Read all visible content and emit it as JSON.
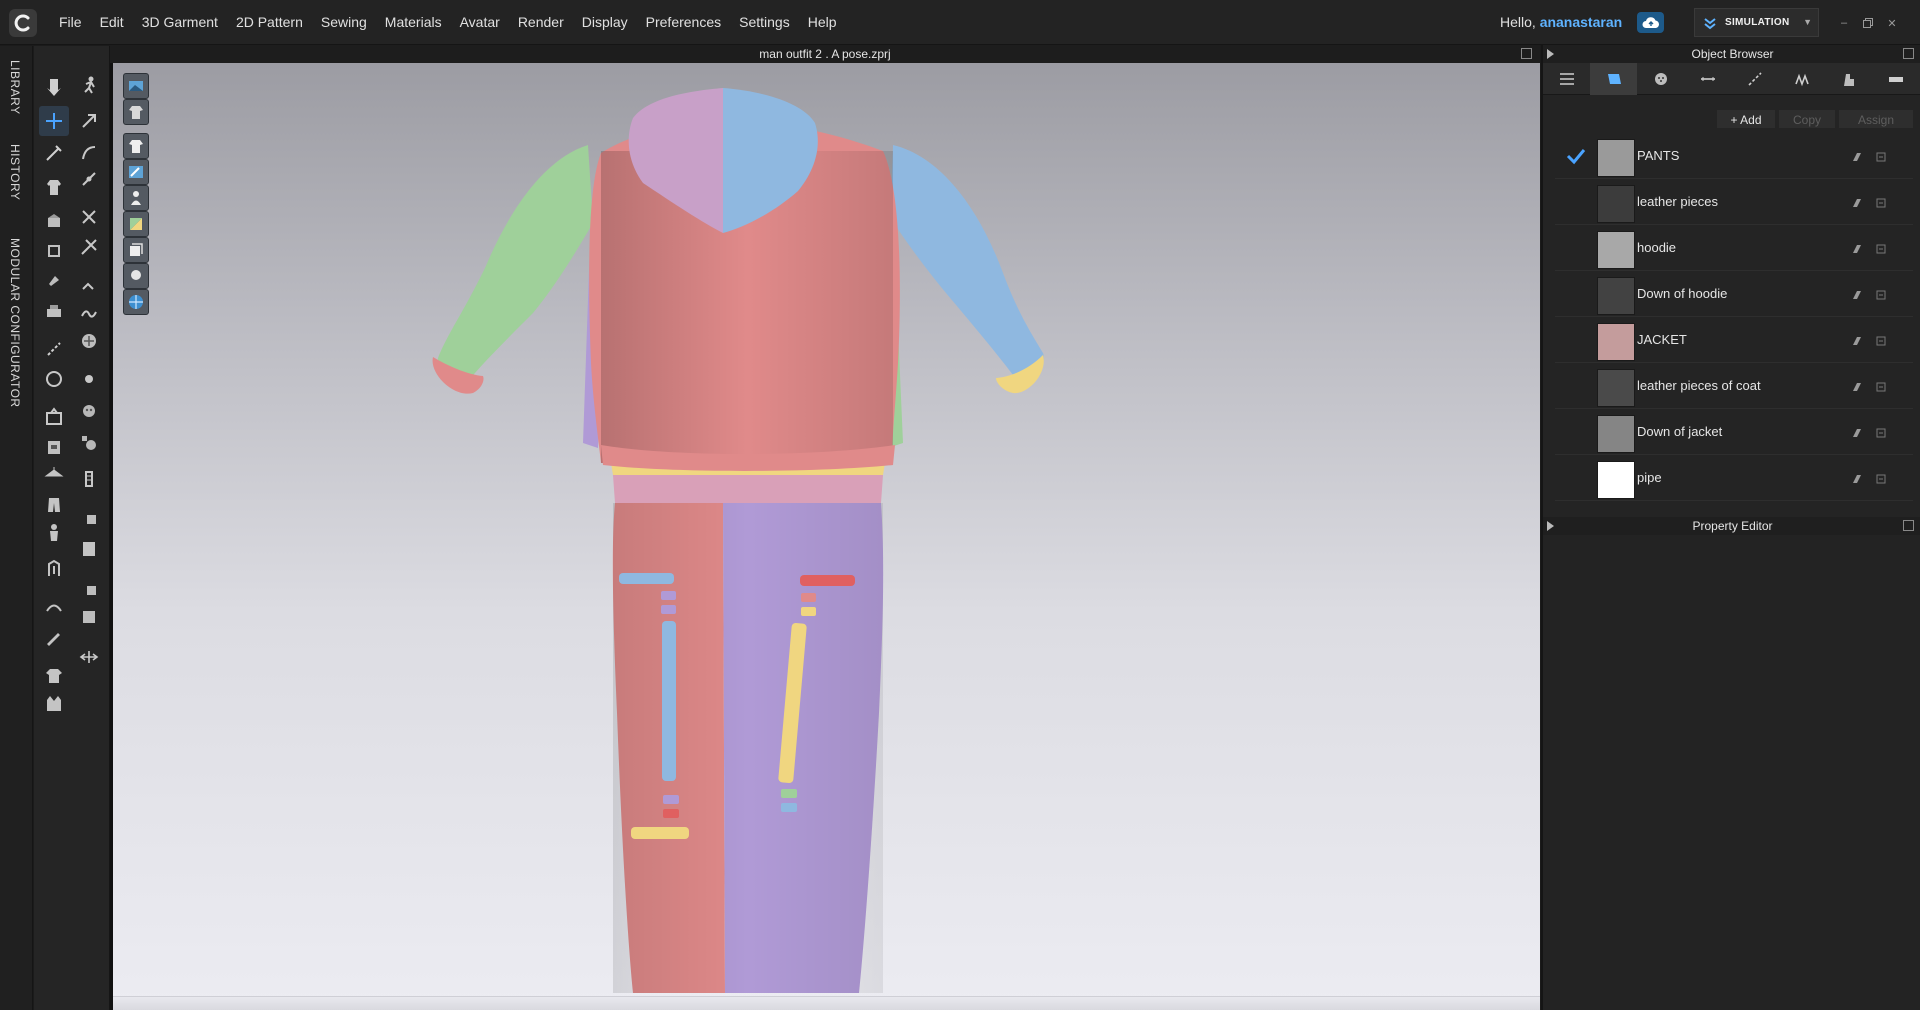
{
  "menu": {
    "items": [
      "File",
      "Edit",
      "3D Garment",
      "2D Pattern",
      "Sewing",
      "Materials",
      "Avatar",
      "Render",
      "Display",
      "Preferences",
      "Settings",
      "Help"
    ],
    "greeting": "Hello,",
    "username": "ananastaran",
    "mode": "SIMULATION"
  },
  "side_tabs": [
    "LIBRARY",
    "HISTORY",
    "MODULAR CONFIGURATOR"
  ],
  "viewport": {
    "title": "man outfit 2 . A pose.zprj"
  },
  "colors": {
    "pink": "#e08a8a",
    "blue": "#8fb8e0",
    "green": "#9fd09a",
    "purple": "#b09ad6",
    "yellow": "#f0d680",
    "hood_purple": "#c8a0c8",
    "waist_pink": "#d9a0b8",
    "accent": "#5fb3ff"
  },
  "object_browser": {
    "title": "Object Browser",
    "tabs": [
      "list-icon",
      "fabric-icon",
      "button-icon",
      "topstitch-icon",
      "puckering-icon",
      "zipper-icon",
      "avatar-icon",
      "ruler-icon"
    ],
    "active_tab": 1,
    "actions": {
      "add": "Add",
      "copy": "Copy",
      "assign": "Assign"
    },
    "fabrics": [
      {
        "name": "PANTS",
        "color": "#9a9a9a",
        "checked": true
      },
      {
        "name": "leather pieces",
        "color": "#3c3c3c",
        "checked": false
      },
      {
        "name": "hoodie",
        "color": "#a8a8a8",
        "checked": false
      },
      {
        "name": "Down of hoodie",
        "color": "#424242",
        "checked": false
      },
      {
        "name": "JACKET",
        "color": "#c49c9c",
        "checked": false
      },
      {
        "name": "leather pieces of coat",
        "color": "#4a4a4a",
        "checked": false
      },
      {
        "name": "Down of jacket",
        "color": "#858585",
        "checked": false
      },
      {
        "name": "pipe",
        "color": "#ffffff",
        "checked": false
      }
    ]
  },
  "property_editor": {
    "title": "Property Editor"
  }
}
